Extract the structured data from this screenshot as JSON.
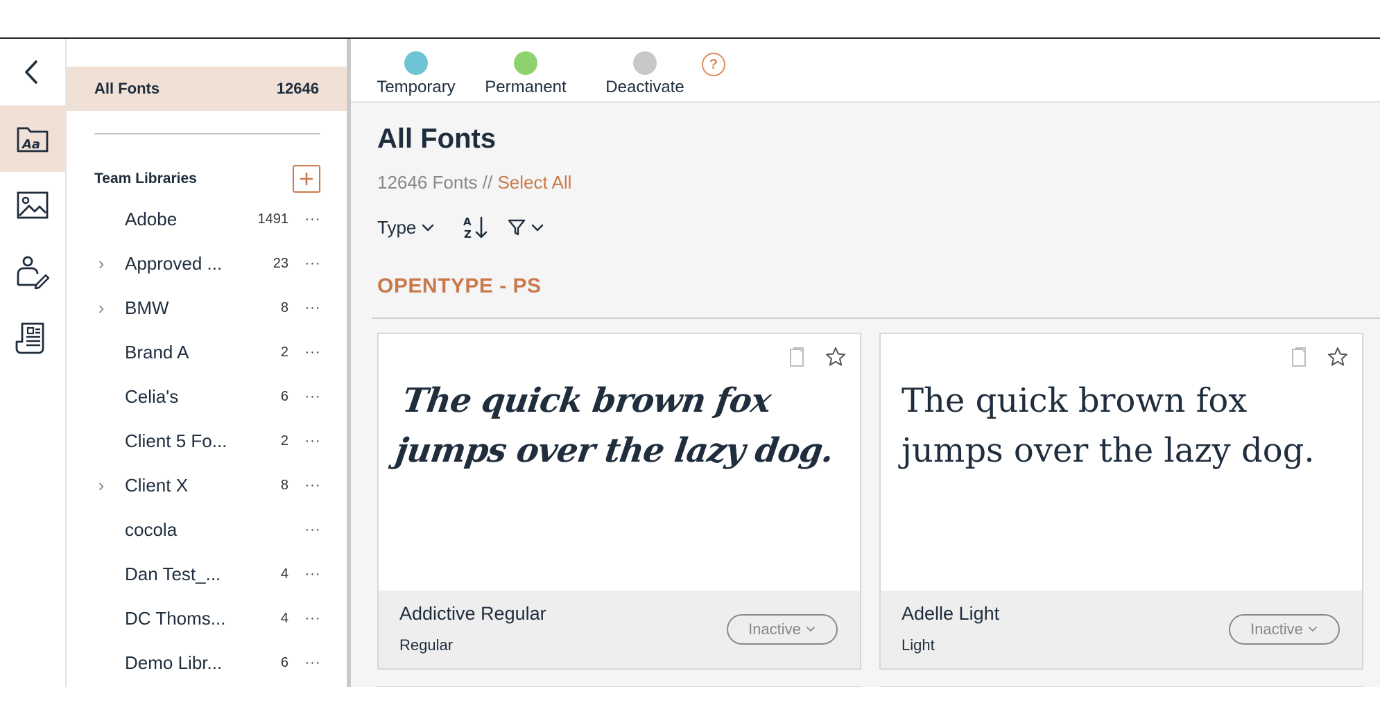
{
  "rail": {
    "items": [
      {
        "name": "back-button",
        "icon": "chevron-left-icon"
      },
      {
        "name": "fonts-nav",
        "icon": "font-folder-icon",
        "active": true
      },
      {
        "name": "images-nav",
        "icon": "image-icon"
      },
      {
        "name": "user-manage-nav",
        "icon": "user-edit-icon"
      },
      {
        "name": "reports-nav",
        "icon": "document-list-icon"
      }
    ]
  },
  "sidebar": {
    "all_fonts_label": "All Fonts",
    "all_fonts_count": "12646",
    "team_libraries_label": "Team Libraries",
    "add_icon": "plus-box-icon",
    "libraries": [
      {
        "name": "Adobe",
        "count": "1491",
        "expandable": false
      },
      {
        "name": "Approved ...",
        "count": "23",
        "expandable": true
      },
      {
        "name": "BMW",
        "count": "8",
        "expandable": true
      },
      {
        "name": "Brand A",
        "count": "2",
        "expandable": false
      },
      {
        "name": "Celia's",
        "count": "6",
        "expandable": false
      },
      {
        "name": "Client 5 Fo...",
        "count": "2",
        "expandable": false
      },
      {
        "name": "Client X",
        "count": "8",
        "expandable": true
      },
      {
        "name": "cocola",
        "count": "",
        "expandable": false
      },
      {
        "name": "Dan Test_...",
        "count": "4",
        "expandable": false
      },
      {
        "name": "DC Thoms...",
        "count": "4",
        "expandable": false
      },
      {
        "name": "Demo Libr...",
        "count": "6",
        "expandable": false
      }
    ],
    "more_label": "···"
  },
  "status_bar": {
    "temporary": {
      "label": "Temporary",
      "color": "#6cc4d4"
    },
    "permanent": {
      "label": "Permanent",
      "color": "#8fd16f"
    },
    "deactivate": {
      "label": "Deactivate",
      "color": "#c8c8c8"
    },
    "help_label": "?"
  },
  "main": {
    "title": "All Fonts",
    "count_text": "12646 Fonts // ",
    "select_all_label": "Select All",
    "type_filter_label": "Type",
    "section_title": "OPENTYPE - PS",
    "colors": {
      "accent": "#c97a4d",
      "text": "#1f2d3d"
    }
  },
  "cards": [
    {
      "sample": "The quick brown fox jumps over the lazy dog.",
      "font_name": "Addictive Regular",
      "font_style": "Regular",
      "status": "Inactive"
    },
    {
      "sample": "The quick brown fox jumps over the lazy dog.",
      "font_name": "Adelle Light",
      "font_style": "Light",
      "status": "Inactive"
    }
  ]
}
